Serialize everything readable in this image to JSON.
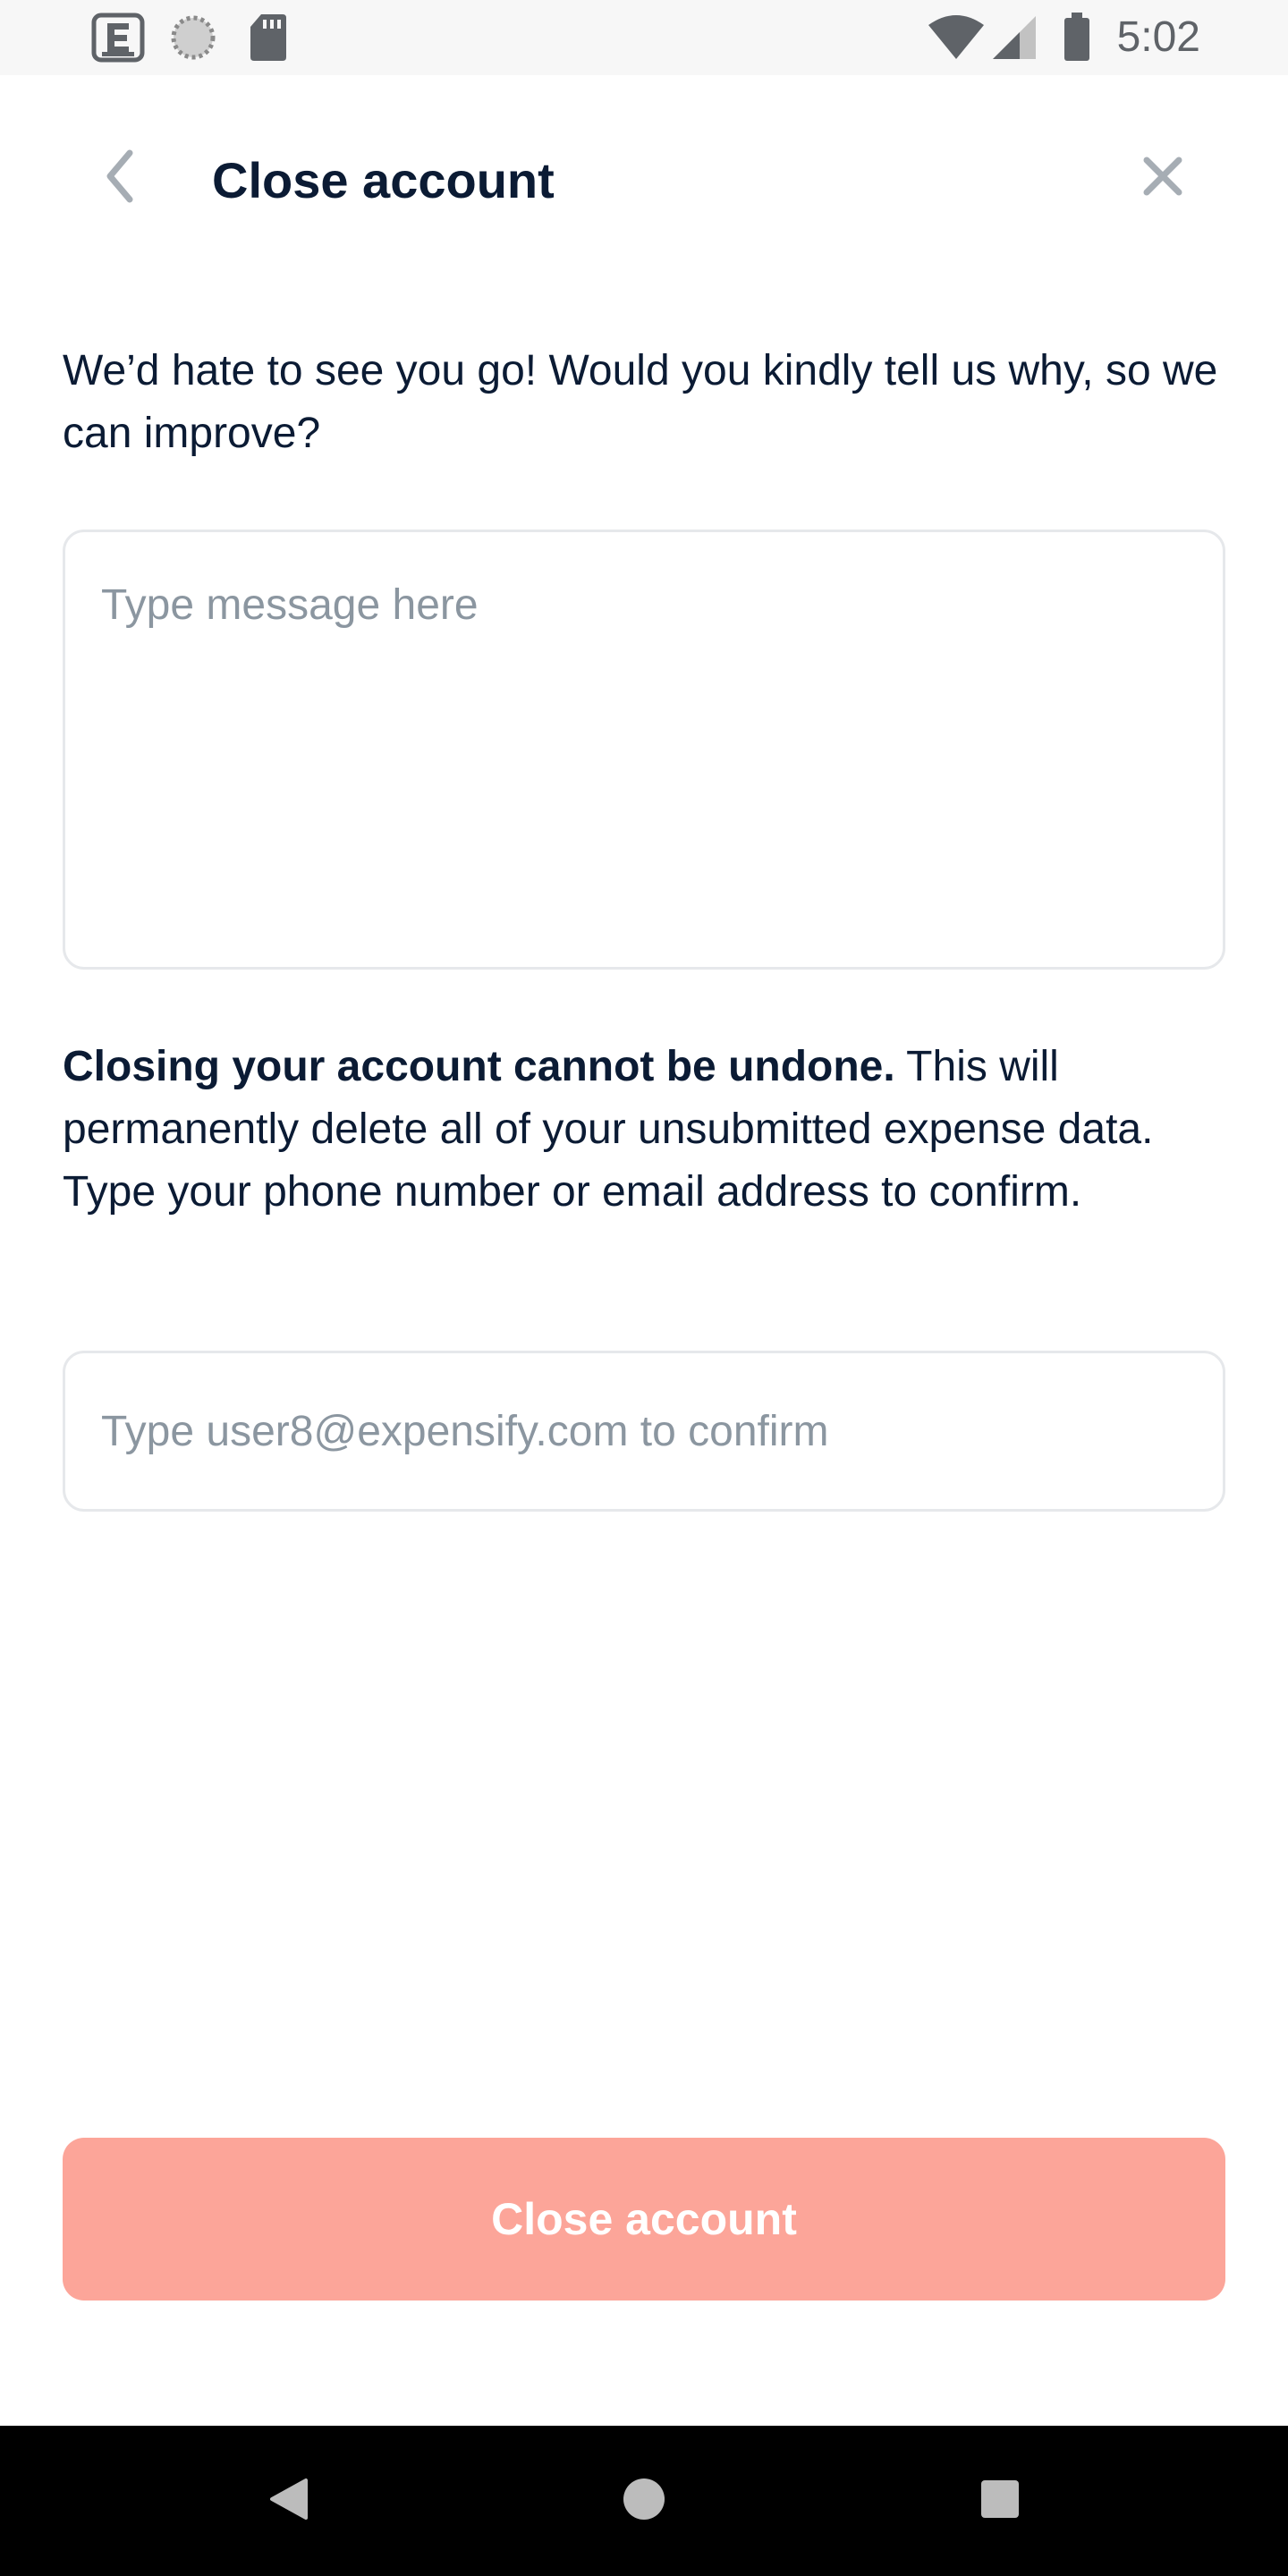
{
  "status_bar": {
    "time": "5:02",
    "icons": [
      "expensify-e-icon",
      "loading-circle-icon",
      "sd-card-icon",
      "wifi-icon",
      "cellular-signal-icon",
      "battery-icon"
    ]
  },
  "header": {
    "title": "Close account",
    "back_icon": "chevron-left-icon",
    "close_icon": "close-x-icon"
  },
  "main": {
    "prompt": "We’d hate to see you go! Would you kindly tell us why, so we can improve?",
    "message_placeholder": "Type message here",
    "warning_bold": "Closing your account cannot be undone.",
    "warning_rest": " This will permanently delete all of your unsubmitted expense data. Type your phone number or email address to confirm.",
    "confirm_placeholder": "Type user8@expensify.com to confirm",
    "submit_label": "Close account"
  },
  "nav_bar": {
    "icons": [
      "back-triangle-icon",
      "home-circle-icon",
      "recents-square-icon"
    ]
  },
  "colors": {
    "text": "#0b1b34",
    "placeholder": "#8b96a0",
    "border": "#e6e8eb",
    "danger_disabled": "#fca599"
  }
}
